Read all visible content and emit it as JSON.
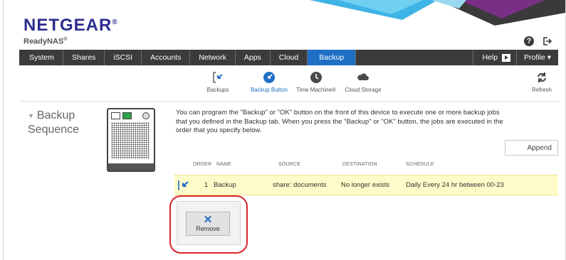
{
  "brand": {
    "name": "NETGEAR",
    "trademark": "®",
    "product": "ReadyNAS",
    "product_mark": "®"
  },
  "header_icons": [
    "help-icon",
    "logout-icon"
  ],
  "nav": {
    "items": [
      "System",
      "Shares",
      "iSCSI",
      "Accounts",
      "Network",
      "Apps",
      "Cloud",
      "Backup"
    ],
    "active": "Backup",
    "help": "Help",
    "profile": "Profile ▾"
  },
  "subnav": {
    "items": [
      {
        "label": "Backups",
        "icon": "backups-icon"
      },
      {
        "label": "Backup Button",
        "icon": "backup-button-icon"
      },
      {
        "label": "Time Machine®",
        "icon": "time-machine-icon"
      },
      {
        "label": "Cloud Storage",
        "icon": "cloud-storage-icon"
      }
    ],
    "active": "Backup Button",
    "refresh": "Refresh"
  },
  "section": {
    "title_line1": "Backup",
    "title_line2": "Sequence",
    "description": "You can program the \"Backup\" or \"OK\" button on the front of this device to execute one or more backup jobs that you defined in the Backup tab. When you press the \"Backup\" or \"OK\" button, the jobs are executed in the order that you specify below."
  },
  "append_label": "Append",
  "table": {
    "headers": [
      "ORDER",
      "NAME",
      "SOURCE",
      "DESTINATION",
      "SCHEDULE"
    ],
    "rows": [
      {
        "order": "1",
        "name": "Backup",
        "source": "share: documents",
        "destination": "No longer exists",
        "schedule": "Daily Every 24 hr between 00-23"
      }
    ]
  },
  "remove_label": "Remove",
  "colors": {
    "accent": "#1f6fc5",
    "navbar": "#3b3b3b",
    "highlight_row": "#fdfbc8",
    "callout": "#d9262c",
    "brand": "#2c2d8f"
  }
}
